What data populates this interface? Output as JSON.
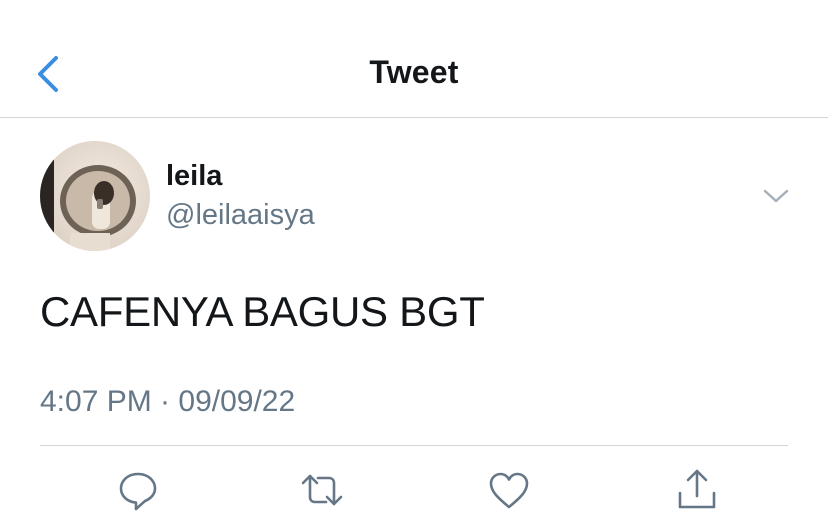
{
  "header": {
    "title": "Tweet",
    "back_icon": "chevron-left-icon"
  },
  "tweet": {
    "display_name": "leila",
    "username": "@leilaaisya",
    "text": "CAFENYA BAGUS BGT",
    "timestamp": "4:07 PM · 09/09/22"
  },
  "actions": [
    {
      "name": "reply",
      "icon": "comment-icon"
    },
    {
      "name": "retweet",
      "icon": "retweet-icon"
    },
    {
      "name": "like",
      "icon": "heart-icon"
    },
    {
      "name": "share",
      "icon": "share-icon"
    }
  ],
  "colors": {
    "accent": "#1d9bf0",
    "text_primary": "#14171a",
    "text_secondary": "#657786",
    "divider": "#cfd6dc"
  }
}
